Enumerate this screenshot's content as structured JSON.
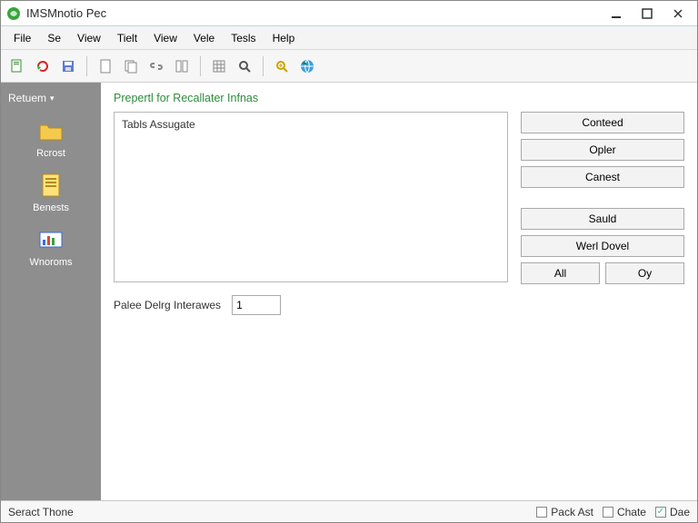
{
  "window": {
    "title": "IMSMnotio Pec"
  },
  "menubar": {
    "items": [
      "File",
      "Se",
      "View",
      "Tielt",
      "View",
      "Vele",
      "Tesls",
      "Help"
    ]
  },
  "toolbar": {
    "icons": [
      "new-doc-icon",
      "refresh-icon",
      "save-icon",
      "page-icon",
      "copy-icon",
      "link-icon",
      "split-icon",
      "grid-icon",
      "search-icon",
      "zoom-icon",
      "globe-icon"
    ]
  },
  "sidebar": {
    "header": "Retuem",
    "items": [
      {
        "label": "Rcrost",
        "icon": "folder-icon"
      },
      {
        "label": "Benests",
        "icon": "sheet-icon"
      },
      {
        "label": "Wnoroms",
        "icon": "chart-icon"
      }
    ]
  },
  "main": {
    "panel_title": "Prepertl for Recallater Infnas",
    "list_items": [
      "Tabls Assugate"
    ],
    "buttons": {
      "conteed": "Conteed",
      "opler": "Opler",
      "canest": "Canest",
      "sauid": "Sauld",
      "wert_dovel": "Werl Dovel",
      "all": "All",
      "oy": "Oy"
    },
    "field_label": "Palee Delrg Interawes",
    "field_value": "1"
  },
  "statusbar": {
    "left": "Seract Thone",
    "checks": [
      {
        "label": "Pack Ast",
        "checked": false
      },
      {
        "label": "Chate",
        "checked": false
      },
      {
        "label": "Dae",
        "checked": true
      }
    ]
  }
}
